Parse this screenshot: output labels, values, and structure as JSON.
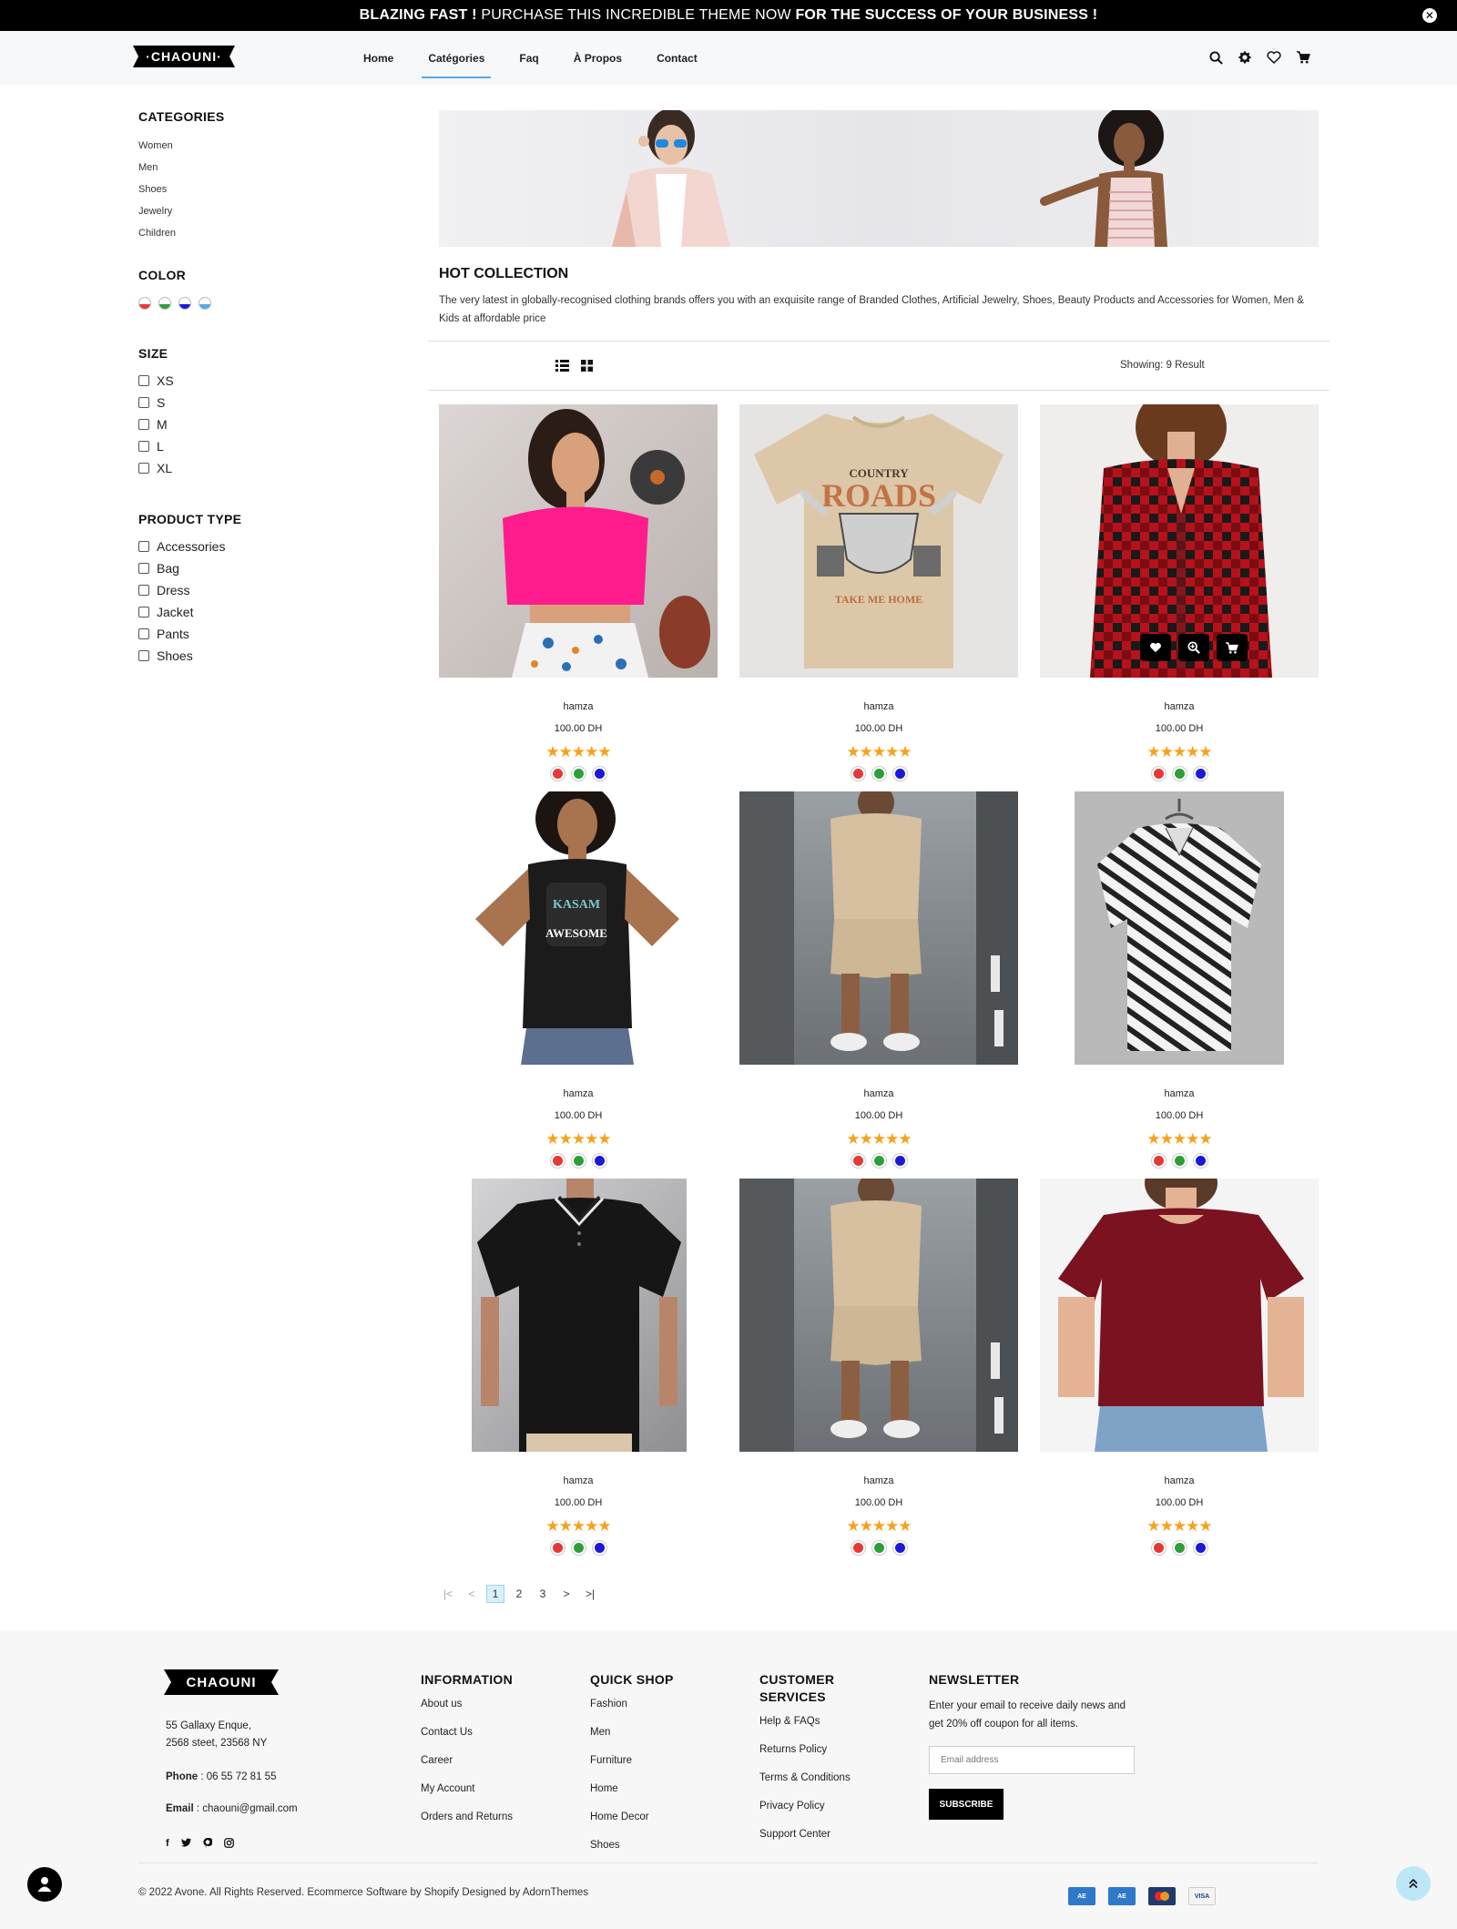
{
  "announcement": {
    "part1": "BLAZING FAST !",
    "part2": " PURCHASE THIS INCREDIBLE THEME NOW ",
    "part3": "FOR THE SUCCESS OF YOUR BUSINESS !",
    "close_icon": "close-circle-icon"
  },
  "header": {
    "logo_text": "·CHAOUNI·",
    "nav": [
      "Home",
      "Catégories",
      "Faq",
      "À Propos",
      "Contact"
    ],
    "active_nav": "Catégories",
    "icons": [
      "search-icon",
      "gear-icon",
      "heart-icon",
      "cart-icon"
    ]
  },
  "sidebar": {
    "categories_title": "CATEGORIES",
    "categories": [
      "Women",
      "Men",
      "Shoes",
      "Jewelry",
      "Children"
    ],
    "color_title": "COLOR",
    "colors": [
      "#e53935",
      "#2e9e3a",
      "#1a1ad6",
      "#5aa9e6"
    ],
    "size_title": "SIZE",
    "sizes": [
      "XS",
      "S",
      "M",
      "L",
      "XL"
    ],
    "product_type_title": "PRODUCT TYPE",
    "product_types": [
      "Accessories",
      "Bag",
      "Dress",
      "Jacket",
      "Pants",
      "Shoes"
    ]
  },
  "collection": {
    "title": "HOT COLLECTION",
    "description": "The very latest in globally-recognised clothing brands offers you with an exquisite range of Branded Clothes, Artificial Jewelry, Shoes, Beauty Products and Accessories for Women, Men & Kids at affordable price"
  },
  "toolbar": {
    "showing": "Showing: 9 Result",
    "view_icons": [
      "list-view-icon",
      "grid-view-icon"
    ]
  },
  "products": [
    {
      "name": "hamza",
      "price": "100.00 DH",
      "rating": 5,
      "image": "woman-pink-crop-top"
    },
    {
      "name": "hamza",
      "price": "100.00 DH",
      "rating": 5,
      "image": "country-roads-tshirt"
    },
    {
      "name": "hamza",
      "price": "100.00 DH",
      "rating": 5,
      "image": "woman-red-plaid-shirt"
    },
    {
      "name": "hamza",
      "price": "100.00 DH",
      "rating": 5,
      "image": "woman-black-awesome-tshirt"
    },
    {
      "name": "hamza",
      "price": "100.00 DH",
      "rating": 5,
      "image": "man-beige-shorts-set"
    },
    {
      "name": "hamza",
      "price": "100.00 DH",
      "rating": 5,
      "image": "patterned-shirt-hanger"
    },
    {
      "name": "hamza",
      "price": "100.00 DH",
      "rating": 5,
      "image": "black-polo-shirt"
    },
    {
      "name": "hamza",
      "price": "100.00 DH",
      "rating": 5,
      "image": "man-beige-shorts-set"
    },
    {
      "name": "hamza",
      "price": "100.00 DH",
      "rating": 5,
      "image": "woman-burgundy-blouse"
    }
  ],
  "swatch_colors": [
    "#e53935",
    "#2e9e3a",
    "#1a1ad6"
  ],
  "pagination": {
    "first": "|<",
    "prev": "<",
    "pages": [
      "1",
      "2",
      "3"
    ],
    "current": "1",
    "next": ">",
    "last": ">|"
  },
  "footer": {
    "logo_text": "CHAOUNI",
    "address_line1": "55 Gallaxy Enque,",
    "address_line2": "2568 steet, 23568 NY",
    "phone_label": "Phone",
    "phone": " : 06 55 72 81 55",
    "email_label": "Email",
    "email": " : chaouni@gmail.com",
    "socials": [
      "facebook-icon",
      "twitter-icon",
      "pinterest-icon",
      "instagram-icon"
    ],
    "information_title": "INFORMATION",
    "information": [
      "About us",
      "Contact Us",
      "Career",
      "My Account",
      "Orders and Returns"
    ],
    "quickshop_title": "QUICK SHOP",
    "quickshop": [
      "Fashion",
      "Men",
      "Furniture",
      "Home",
      "Home Decor",
      "Shoes"
    ],
    "customer_title_line1": "CUSTOMER",
    "customer_title_line2": "SERVICES",
    "customer": [
      "Help & FAQs",
      "Returns Policy",
      "Terms & Conditions",
      "Privacy Policy",
      "Support Center"
    ],
    "newsletter_title": "NEWSLETTER",
    "newsletter_text": "Enter your email to receive daily news and get 20% off coupon for all items.",
    "email_placeholder": "Email address",
    "subscribe_label": "SUBSCRIBE",
    "copyright": "© 2022 Avone. All Rights Reserved. Ecommerce Software by Shopify Designed by AdornThemes",
    "payments": [
      "amex-icon",
      "amex-icon",
      "mastercard-icon",
      "visa-icon"
    ]
  }
}
